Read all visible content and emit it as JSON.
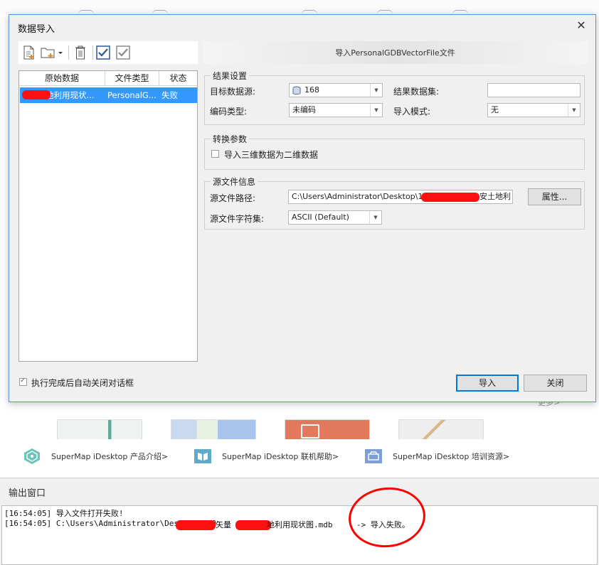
{
  "dialog": {
    "title": "数据导入",
    "banner": "导入PersonalGDBVectorFile文件",
    "toolbar": [
      "add-file-icon",
      "add-folder-icon",
      "delete-icon",
      "select-all-icon",
      "select-inverse-icon"
    ],
    "list": {
      "headers": [
        "原始数据",
        "文件类型",
        "状态"
      ],
      "rows": [
        {
          "source": "地利用现状...",
          "type": "PersonalG...",
          "status": "失败"
        }
      ]
    },
    "result_settings": {
      "title": "结果设置",
      "target_datasource_label": "目标数据源:",
      "target_datasource_value": "168",
      "result_dataset_label": "结果数据集:",
      "result_dataset_value": "",
      "encoding_label": "编码类型:",
      "encoding_value": "未编码",
      "import_mode_label": "导入模式:",
      "import_mode_value": "无"
    },
    "convert_params": {
      "title": "转换参数",
      "import_3d_as_2d": "导入三维数据为二维数据"
    },
    "source_info": {
      "title": "源文件信息",
      "path_label": "源文件路径:",
      "path_value": "C:\\Users\\Administrator\\Desktop\\110\\",
      "path_suffix": "安土地利",
      "properties_button": "属性...",
      "charset_label": "源文件字符集:",
      "charset_value": "ASCII (Default)"
    },
    "auto_close": "执行完成后自动关闭对话框",
    "import_button": "导入",
    "close_button": "关闭"
  },
  "links": [
    {
      "label": "SuperMap iDesktop 产品介绍>",
      "icon": "product-intro-icon"
    },
    {
      "label": "SuperMap iDesktop 联机帮助>",
      "icon": "online-help-icon"
    },
    {
      "label": "SuperMap iDesktop 培训资源>",
      "icon": "training-resource-icon"
    }
  ],
  "background": {
    "more": "更多>"
  },
  "output": {
    "title": "输出窗口",
    "lines": [
      "[16:54:05] 导入文件打开失败!",
      "[16:54:05] C:\\Users\\Administrator\\Desktop\\110"
    ],
    "line2_mid1": "矢量",
    "line2_mid2": "地利用现状图.mdb",
    "line2_tail": "-> 导入失败。"
  },
  "colors": {
    "selection": "#3399ff",
    "accent": "#0078d7",
    "annotation": "#ff0000"
  }
}
